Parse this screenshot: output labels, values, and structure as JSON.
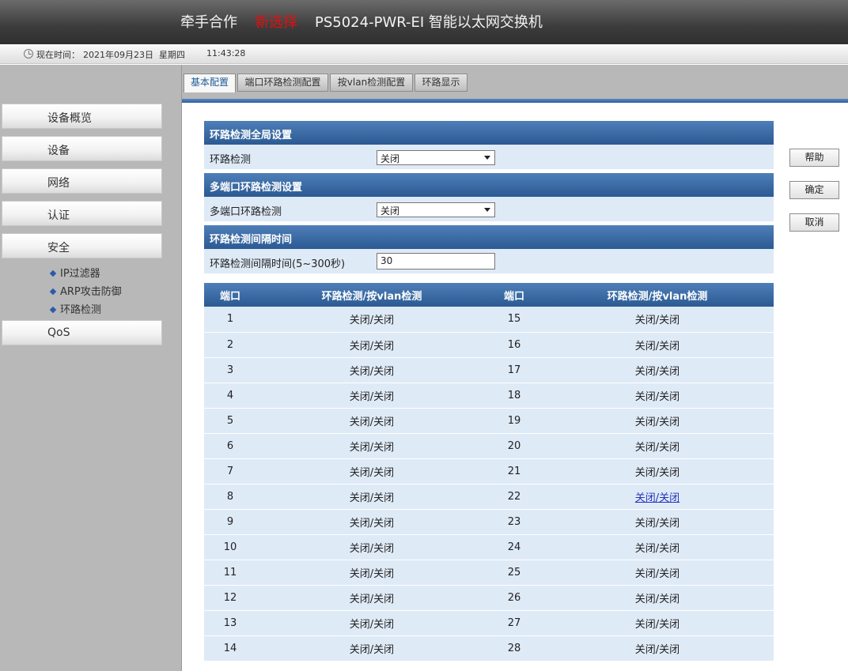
{
  "header": {
    "brand": "牵手合作",
    "tag": "新选择",
    "product": "PS5024-PWR-EI 智能以太网交换机"
  },
  "timebar": {
    "label": "现在时间：",
    "date": "2021年09月23日",
    "weekday": "星期四",
    "time": "11:43:28"
  },
  "sidebar": {
    "items": [
      {
        "label": "设备概览"
      },
      {
        "label": "设备"
      },
      {
        "label": "网络"
      },
      {
        "label": "认证"
      },
      {
        "label": "安全"
      },
      {
        "label": "QoS"
      }
    ],
    "sub_items": [
      {
        "label": "IP过滤器"
      },
      {
        "label": "ARP攻击防御"
      },
      {
        "label": "环路检测"
      }
    ]
  },
  "tabs": [
    {
      "label": "基本配置",
      "active": true
    },
    {
      "label": "端口环路检测配置",
      "active": false
    },
    {
      "label": "按vlan检测配置",
      "active": false
    },
    {
      "label": "环路显示",
      "active": false
    }
  ],
  "sections": {
    "global": {
      "title": "环路检测全局设置",
      "field_label": "环路检测",
      "value": "关闭"
    },
    "multiport": {
      "title": "多端口环路检测设置",
      "field_label": "多端口环路检测",
      "value": "关闭"
    },
    "interval": {
      "title": "环路检测间隔时间",
      "field_label": "环路检测间隔时间(5~300秒)",
      "value": "30"
    }
  },
  "port_table": {
    "headers": [
      "端口",
      "环路检测/按vlan检测",
      "端口",
      "环路检测/按vlan检测"
    ],
    "rows": [
      [
        "1",
        "关闭/关闭",
        "15",
        "关闭/关闭"
      ],
      [
        "2",
        "关闭/关闭",
        "16",
        "关闭/关闭"
      ],
      [
        "3",
        "关闭/关闭",
        "17",
        "关闭/关闭"
      ],
      [
        "4",
        "关闭/关闭",
        "18",
        "关闭/关闭"
      ],
      [
        "5",
        "关闭/关闭",
        "19",
        "关闭/关闭"
      ],
      [
        "6",
        "关闭/关闭",
        "20",
        "关闭/关闭"
      ],
      [
        "7",
        "关闭/关闭",
        "21",
        "关闭/关闭"
      ],
      [
        "8",
        "关闭/关闭",
        "22",
        "关闭/关闭"
      ],
      [
        "9",
        "关闭/关闭",
        "23",
        "关闭/关闭"
      ],
      [
        "10",
        "关闭/关闭",
        "24",
        "关闭/关闭"
      ],
      [
        "11",
        "关闭/关闭",
        "25",
        "关闭/关闭"
      ],
      [
        "12",
        "关闭/关闭",
        "26",
        "关闭/关闭"
      ],
      [
        "13",
        "关闭/关闭",
        "27",
        "关闭/关闭"
      ],
      [
        "14",
        "关闭/关闭",
        "28",
        "关闭/关闭"
      ]
    ]
  },
  "buttons": {
    "help": "帮助",
    "ok": "确定",
    "cancel": "取消"
  }
}
